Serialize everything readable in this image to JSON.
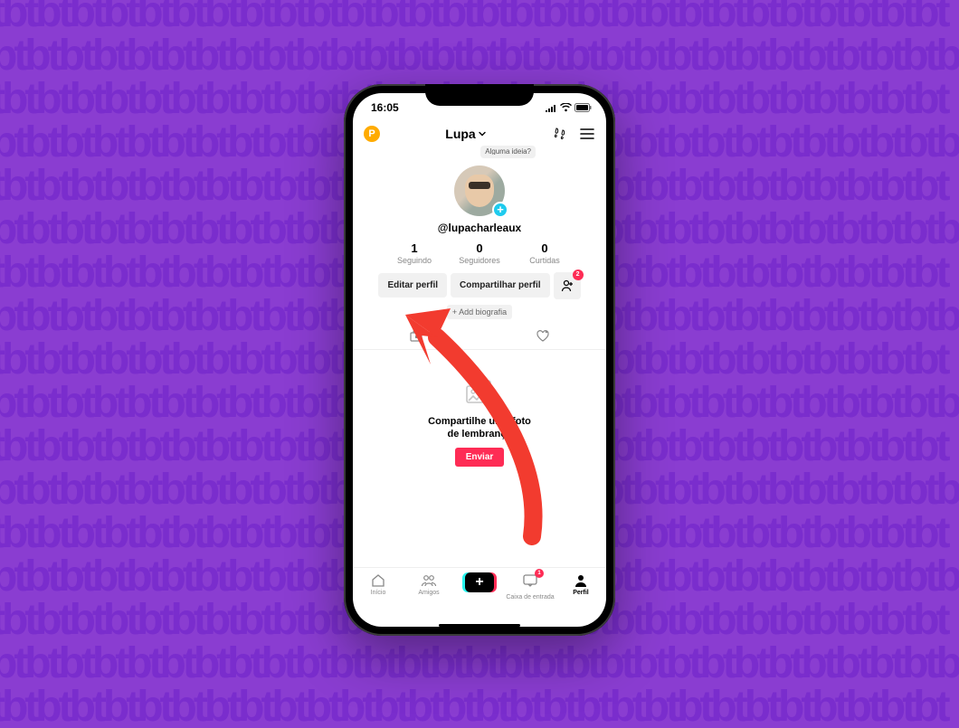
{
  "status": {
    "time": "16:05"
  },
  "header": {
    "badge_letter": "P",
    "title": "Lupa"
  },
  "profile": {
    "tooltip": "Alguma ideia?",
    "handle": "@lupacharleaux"
  },
  "stats": {
    "following": {
      "num": "1",
      "label": "Seguindo"
    },
    "followers": {
      "num": "0",
      "label": "Seguidores"
    },
    "likes": {
      "num": "0",
      "label": "Curtidas"
    }
  },
  "actions": {
    "edit": "Editar perfil",
    "share": "Compartilhar perfil",
    "add_friends_badge": "2",
    "add_bio": "+ Add biografia"
  },
  "empty": {
    "title": "Compartilhe uma foto de lembrança",
    "button": "Enviar"
  },
  "nav": {
    "home": "Início",
    "friends": "Amigos",
    "inbox": "Caixa de entrada",
    "inbox_badge": "1",
    "profile": "Perfil"
  }
}
